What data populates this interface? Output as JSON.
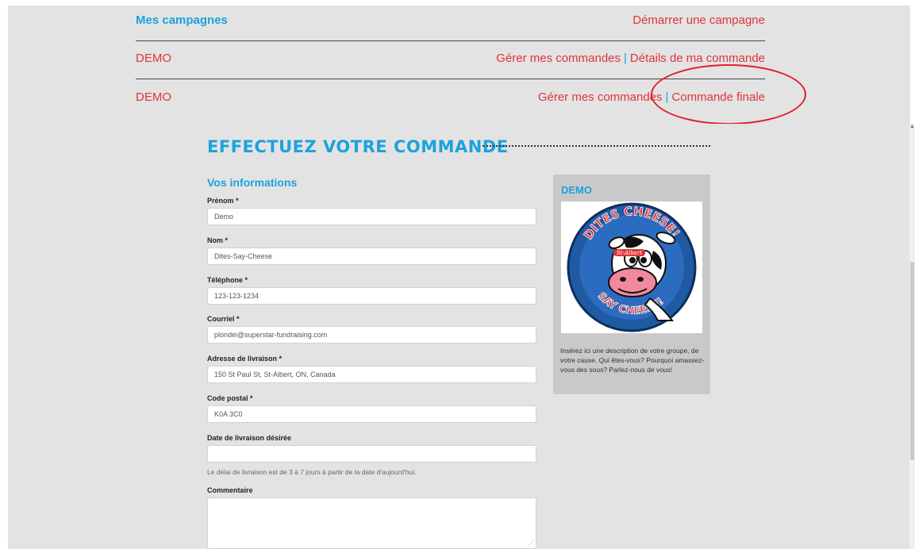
{
  "campaigns": {
    "title": "Mes campagnes",
    "start_link": "Démarrer une campagne",
    "rows": [
      {
        "name": "DEMO",
        "manage_link": "Gérer mes commandes",
        "detail_link": "Détails de ma commande"
      },
      {
        "name": "DEMO",
        "manage_link": "Gérer mes commandes",
        "detail_link": "Commande finale"
      }
    ]
  },
  "order": {
    "heading": "EFFECTUEZ VOTRE COMMANDE",
    "section_title": "Vos informations",
    "fields": {
      "first_name": {
        "label": "Prénom *",
        "value": "Demo"
      },
      "last_name": {
        "label": "Nom *",
        "value": "Dites-Say-Cheese"
      },
      "phone": {
        "label": "Téléphone *",
        "value": "123-123-1234"
      },
      "email": {
        "label": "Courriel *",
        "value": "plondei@superstar-fundraising.com"
      },
      "address": {
        "label": "Adresse de livraison *",
        "value": "150 St Paul St, St-Albert, ON, Canada"
      },
      "postal": {
        "label": "Code postal *",
        "value": "K0A 3C0"
      },
      "date": {
        "label": "Date de livraison désirée",
        "value": ""
      },
      "comment": {
        "label": "Commentaire",
        "value": ""
      }
    },
    "delivery_note": "Le délai de livraison est de 3 à 7 jours à partir de la date d'aujourd'hui."
  },
  "sidebar": {
    "title": "DEMO",
    "logo_text_top": "DITES CHEESE!",
    "logo_text_bottom": "SAY CHEESE!",
    "logo_brand": "St-Albert",
    "description": "Insérez ici une description de votre groupe, de votre cause. Qui êtes-vous? Pourquoi amassez-vous des sous? Parlez-nous de vous!"
  },
  "colors": {
    "accent_blue": "#1aa3dd",
    "link_red": "#e0343a",
    "highlight": "#e0202a"
  }
}
